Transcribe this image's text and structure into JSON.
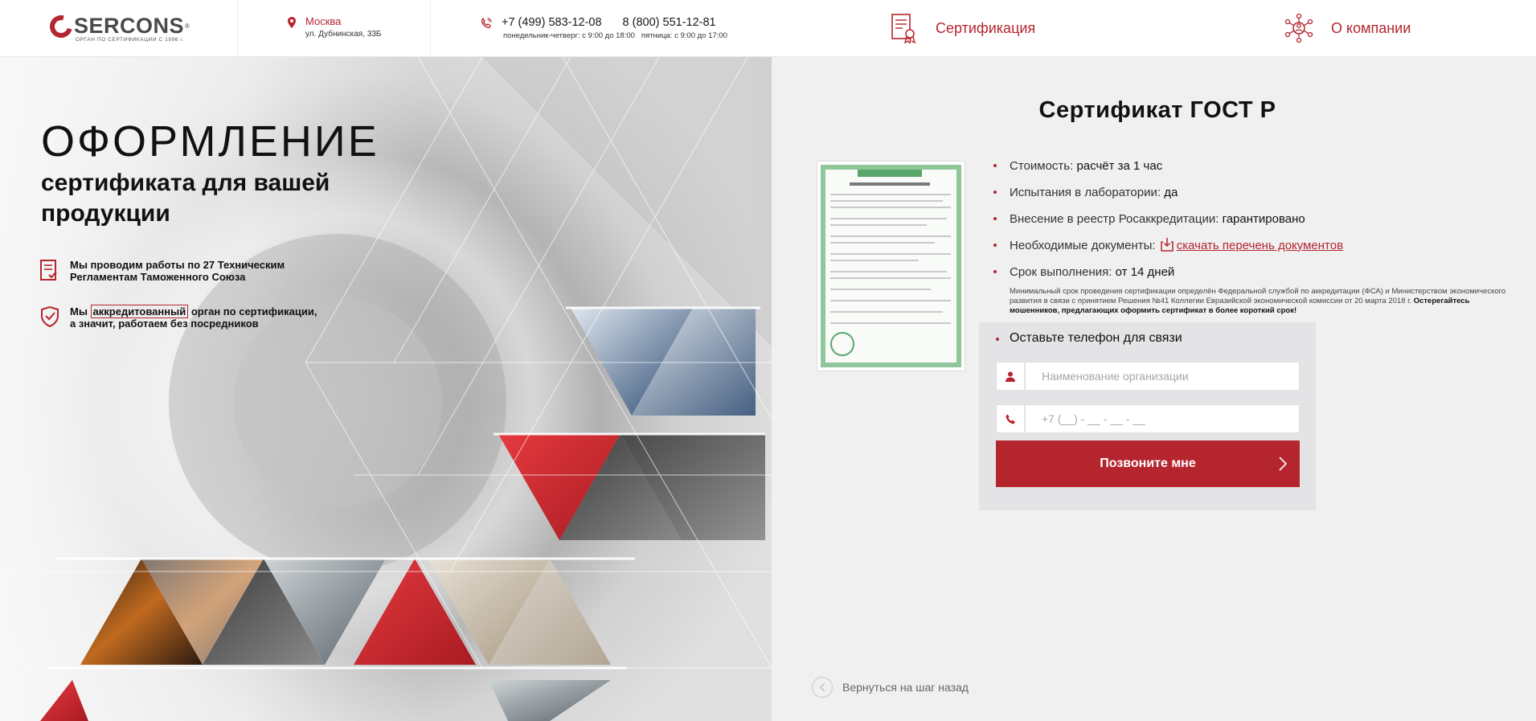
{
  "header": {
    "logo": {
      "name": "SERCONS",
      "reg": "®",
      "tagline": "ОРГАН ПО СЕРТИФИКАЦИИ С 1996 г."
    },
    "address": {
      "city": "Москва",
      "street": "ул. Дубнинская, 33Б",
      "icon": "map-pin-icon"
    },
    "contacts": {
      "phone1": "+7 (499) 583-12-08",
      "phone2": "8 (800) 551-12-81",
      "hours1": "понедельник-четверг: с 9:00 до 18:00",
      "hours2": "пятница: с 9:00 до 17:00",
      "icon": "phone-icon"
    },
    "nav": [
      {
        "label": "Сертификация",
        "icon": "certificate-icon"
      },
      {
        "label": "О компании",
        "icon": "company-network-icon"
      }
    ]
  },
  "hero": {
    "title": "ОФОРМЛЕНИЕ",
    "subtitle": "сертификата для вашей продукции",
    "features": [
      {
        "icon": "document-check-icon",
        "line1": "Мы проводим работы по 27 Техническим",
        "line2": "Регламентам Таможенного Союза"
      },
      {
        "icon": "shield-check-icon",
        "pre": "Мы ",
        "highlight": "аккредитованный",
        "post": " орган по сертификации,",
        "line2": "а значит, работаем без посредников"
      }
    ]
  },
  "panel": {
    "title": "Сертификат ГОСТ Р",
    "info": [
      {
        "label": "Стоимость: ",
        "value": "расчёт за 1 час"
      },
      {
        "label": "Испытания в лаборатории: ",
        "value": "да"
      },
      {
        "label": "Внесение в реестр Росаккредитации: ",
        "value": "гарантировано"
      },
      {
        "label": "Необходимые документы: ",
        "link": "скачать перечень документов"
      },
      {
        "label": "Срок выполнения: ",
        "value": "от 14 дней"
      }
    ],
    "note": "Минимальный срок проведения сертификации определён Федеральной службой по аккредитации (ФСА) и Министерством экономического развития в связи с принятием Решения №41 Коллегии Евразийской экономической комиссии от 20 марта 2018 г.",
    "note_bold": "Остерегайтесь мошенников, предлагающих оформить сертификат в более короткий срок!",
    "form": {
      "title": "Оставьте телефон для связи",
      "org_placeholder": "Наименование организации",
      "phone_placeholder": "+7 (__) - __ - __ - __",
      "submit": "Позвоните мне"
    },
    "back": "Вернуться на шаг назад"
  },
  "colors": {
    "accent": "#b5252e",
    "panel_bg": "#f0f0f1",
    "form_bg": "#e4e4e6"
  }
}
